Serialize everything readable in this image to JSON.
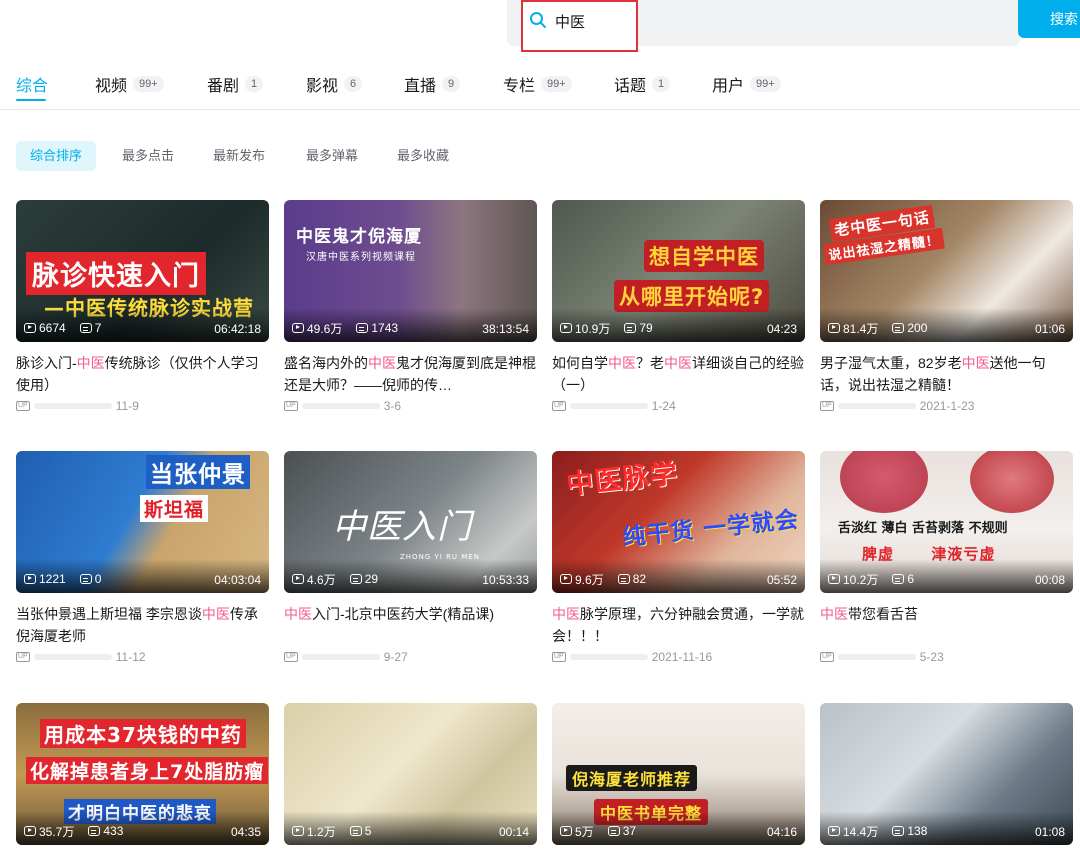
{
  "search": {
    "query": "中医",
    "button_label": "搜索"
  },
  "tabs": [
    {
      "label": "综合",
      "badge": ""
    },
    {
      "label": "视频",
      "badge": "99+"
    },
    {
      "label": "番剧",
      "badge": "1"
    },
    {
      "label": "影视",
      "badge": "6"
    },
    {
      "label": "直播",
      "badge": "9"
    },
    {
      "label": "专栏",
      "badge": "99+"
    },
    {
      "label": "话题",
      "badge": "1"
    },
    {
      "label": "用户",
      "badge": "99+"
    }
  ],
  "sort": [
    "综合排序",
    "最多点击",
    "最新发布",
    "最多弹幕",
    "最多收藏"
  ],
  "colors": {
    "accent": "#00aeec",
    "highlight": "#f25d8e",
    "search_focus": "#e0323c"
  },
  "videos": [
    {
      "views": "6674",
      "danmaku": "7",
      "duration": "06:42:18",
      "title_pre": "脉诊入门-",
      "title_hl": "中医",
      "title_post": "传统脉诊（仅供个人学习使用）",
      "date": "11-9",
      "thumb_text_1": "脉诊快速入门",
      "thumb_text_2": "—中医传统脉诊实战营"
    },
    {
      "views": "49.6万",
      "danmaku": "1743",
      "duration": "38:13:54",
      "title_pre": "盛名海内外的",
      "title_hl": "中医",
      "title_post": "鬼才倪海厦到底是神棍还是大师？——倪师的传…",
      "date": "3-6",
      "thumb_text_1": "中医鬼才倪海厦",
      "thumb_text_2": "汉唐中医系列视频课程"
    },
    {
      "views": "10.9万",
      "danmaku": "79",
      "duration": "04:23",
      "title_pre": "如何自学",
      "title_hl": "中医",
      "title_mid": "？老",
      "title_hl2": "中医",
      "title_post": "详细谈自己的经验（一）",
      "date": "1-24",
      "thumb_text_1": "想自学中医",
      "thumb_text_2": "从哪里开始呢?"
    },
    {
      "views": "81.4万",
      "danmaku": "200",
      "duration": "01:06",
      "title_pre": "男子湿气太重，82岁老",
      "title_hl": "中医",
      "title_post": "送他一句话，说出祛湿之精髓！",
      "date": "2021-1-23",
      "thumb_text_1": "老中医一句话",
      "thumb_text_2": "说出祛湿之精髓！"
    },
    {
      "views": "1221",
      "danmaku": "0",
      "duration": "04:03:04",
      "title_pre": "当张仲景遇上斯坦福 李宗恩谈",
      "title_hl": "中医",
      "title_post": "传承倪海厦老师",
      "date": "11-12",
      "thumb_text_1": "当张仲景",
      "thumb_text_2": "斯坦福"
    },
    {
      "views": "4.6万",
      "danmaku": "29",
      "duration": "10:53:33",
      "title_pre": "",
      "title_hl": "中医",
      "title_post": "入门-北京中医药大学(精品课)",
      "date": "9-27",
      "thumb_text_1": "中医入门",
      "thumb_text_2": "ZHONG YI RU MEN"
    },
    {
      "views": "9.6万",
      "danmaku": "82",
      "duration": "05:52",
      "title_pre": "",
      "title_hl": "中医",
      "title_post": "脉学原理，六分钟融会贯通，一学就会！！！",
      "date": "2021-11-16",
      "thumb_text_1": "中医脉学",
      "thumb_text_2": "纯干货 一学就会"
    },
    {
      "views": "10.2万",
      "danmaku": "6",
      "duration": "00:08",
      "title_pre": "",
      "title_hl": "中医",
      "title_post": "带您看舌苔",
      "date": "5-23",
      "thumb_text_1": "舌淡红 薄白  舌苔剥落 不规则",
      "thumb_text_2": "脾虚      津液亏虚"
    },
    {
      "views": "35.7万",
      "danmaku": "433",
      "duration": "04:35",
      "thumb_text_1": "用成本37块钱的中药",
      "thumb_text_2": "化解掉患者身上7处脂肪瘤",
      "thumb_text_3": "才明白中医的悲哀"
    },
    {
      "views": "1.2万",
      "danmaku": "5",
      "duration": "00:14"
    },
    {
      "views": "5万",
      "danmaku": "37",
      "duration": "04:16",
      "thumb_text_1": "倪海厦老师推荐",
      "thumb_text_2": "中医书单完整"
    },
    {
      "views": "14.4万",
      "danmaku": "138",
      "duration": "01:08"
    }
  ]
}
